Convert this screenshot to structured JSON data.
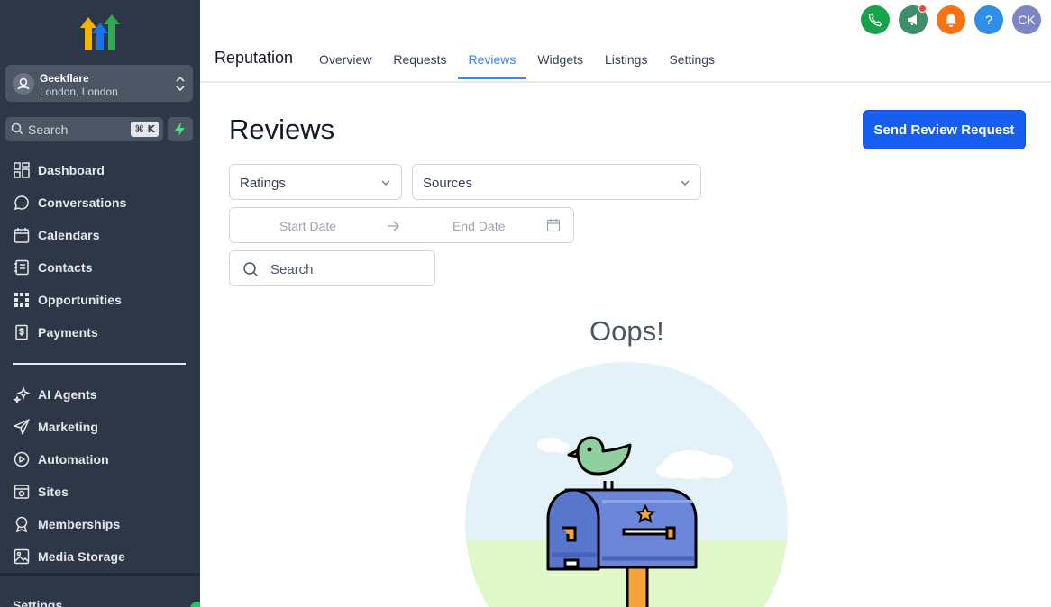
{
  "sidebar": {
    "account": {
      "name": "Geekflare",
      "location": "London, London"
    },
    "search": {
      "placeholder": "Search",
      "shortcut": "⌘ K"
    },
    "nav_top": [
      {
        "label": "Dashboard",
        "icon": "dashboard-icon"
      },
      {
        "label": "Conversations",
        "icon": "chat-icon"
      },
      {
        "label": "Calendars",
        "icon": "calendar-icon"
      },
      {
        "label": "Contacts",
        "icon": "contacts-icon"
      },
      {
        "label": "Opportunities",
        "icon": "opportunities-icon"
      },
      {
        "label": "Payments",
        "icon": "payments-icon"
      }
    ],
    "nav_bottom": [
      {
        "label": "AI Agents",
        "icon": "sparkle-icon"
      },
      {
        "label": "Marketing",
        "icon": "send-icon"
      },
      {
        "label": "Automation",
        "icon": "automation-icon"
      },
      {
        "label": "Sites",
        "icon": "sites-icon"
      },
      {
        "label": "Memberships",
        "icon": "award-icon"
      },
      {
        "label": "Media Storage",
        "icon": "image-icon"
      }
    ],
    "settings_label": "Settings"
  },
  "header": {
    "module_title": "Reputation",
    "tabs": [
      {
        "label": "Overview",
        "active": false
      },
      {
        "label": "Requests",
        "active": false
      },
      {
        "label": "Reviews",
        "active": true
      },
      {
        "label": "Widgets",
        "active": false
      },
      {
        "label": "Listings",
        "active": false
      },
      {
        "label": "Settings",
        "active": false
      }
    ],
    "actions": [
      {
        "icon": "phone-icon",
        "color": "#16a34a"
      },
      {
        "icon": "megaphone-icon",
        "color": "#3e8e6a"
      },
      {
        "icon": "bell-icon",
        "color": "#f97316"
      },
      {
        "icon": "help-icon",
        "color": "#2f8fe6",
        "text": "?"
      },
      {
        "icon": "avatar",
        "color": "#7c86c5",
        "text": "CK"
      }
    ],
    "accent": "#3b82f6"
  },
  "main": {
    "title": "Reviews",
    "primary_button": "Send Review Request",
    "ratings_select": "Ratings",
    "sources_select": "Sources",
    "start_date_placeholder": "Start Date",
    "end_date_placeholder": "End Date",
    "search_placeholder": "Search",
    "empty_title": "Oops!"
  },
  "colors": {
    "sidebar_bg": "#2d3748",
    "primary": "#155eef"
  }
}
